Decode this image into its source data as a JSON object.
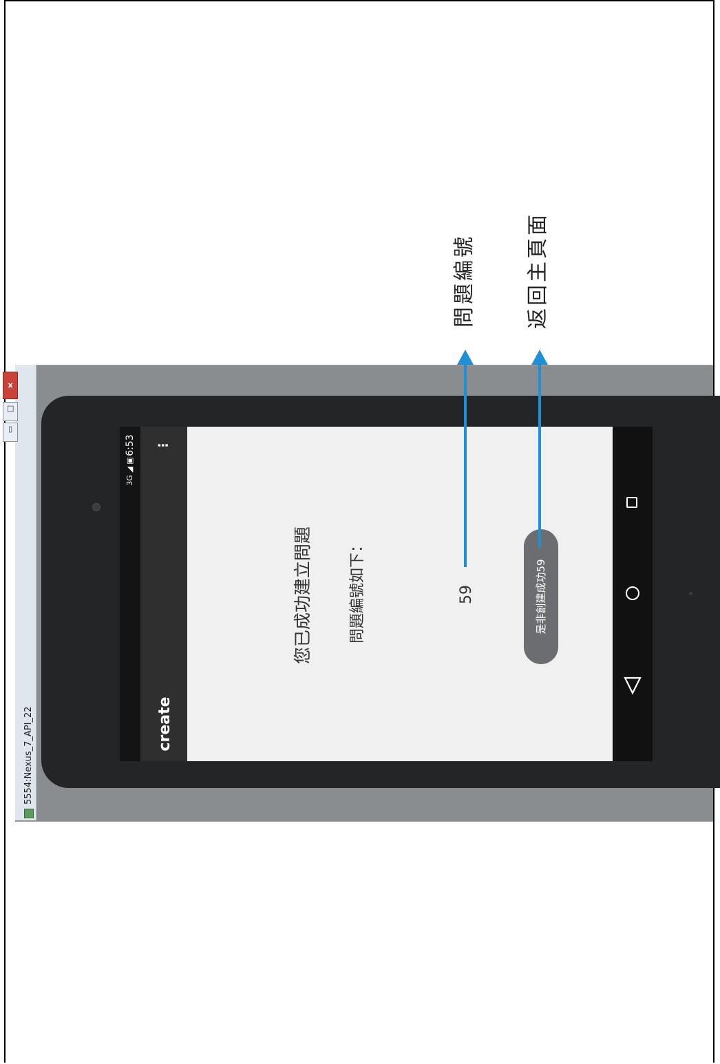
{
  "window": {
    "title": "5554:Nexus_7_API_22",
    "controls": {
      "close": "x",
      "maximize": "□",
      "minimize": "▭"
    }
  },
  "status_bar": {
    "time": "6:53",
    "icons": "3G ◢ ▣"
  },
  "app_bar": {
    "title": "create",
    "overflow": "⋮"
  },
  "content": {
    "heading": "您已成功建立問題",
    "subheading": "問題編號如下：",
    "question_number": "59"
  },
  "toast": {
    "text": "是非創建成功59"
  },
  "nav_bar": {
    "back_icon": "back-icon",
    "home_icon": "home-icon",
    "recent_icon": "recent-apps-icon"
  },
  "annotations": {
    "question_number_label": "問題編號",
    "return_home_label": "返回主頁面",
    "arrow_color": "#1f8fd6"
  }
}
